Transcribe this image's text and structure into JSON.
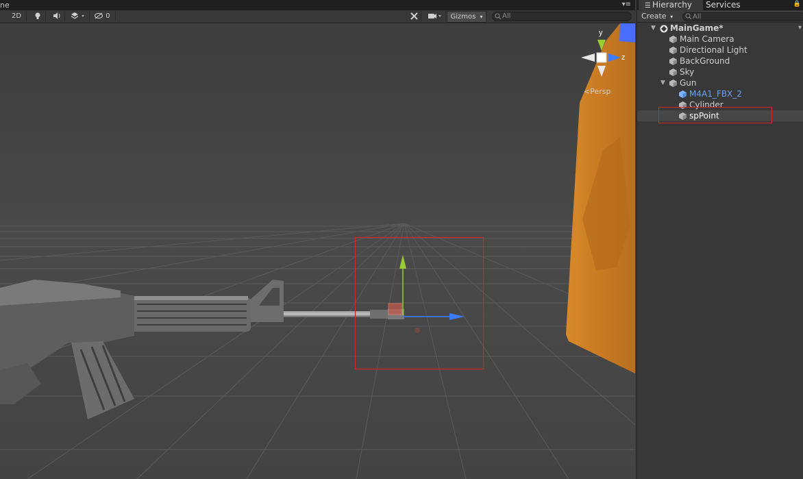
{
  "scene": {
    "tab_label": "ne",
    "menu_icon": "scene-options-menu-icon",
    "toolbar": {
      "mode_2d": "2D",
      "hidden_count": "0",
      "gizmos_label": "Gizmos",
      "search_placeholder": "All"
    },
    "persp_label": "Persp",
    "axis_labels": {
      "y": "y",
      "z": "z"
    }
  },
  "hierarchy": {
    "tabs": [
      "Hierarchy",
      "Services"
    ],
    "create_label": "Create",
    "search_placeholder": "All",
    "scene_name": "MainGame*",
    "items": [
      {
        "label": "Main Camera"
      },
      {
        "label": "Directional Light"
      },
      {
        "label": "BackGround"
      },
      {
        "label": "Sky"
      },
      {
        "label": "Gun"
      },
      {
        "label": "M4A1_FBX_2"
      },
      {
        "label": "Cylinder"
      },
      {
        "label": "spPoint"
      }
    ]
  },
  "colors": {
    "accent_red": "#d42424",
    "prefab_blue": "#4f8fdc",
    "gizmo_blue": "#3d7cff",
    "gizmo_green": "#9acd32",
    "wall_orange": "#d78a2c"
  }
}
